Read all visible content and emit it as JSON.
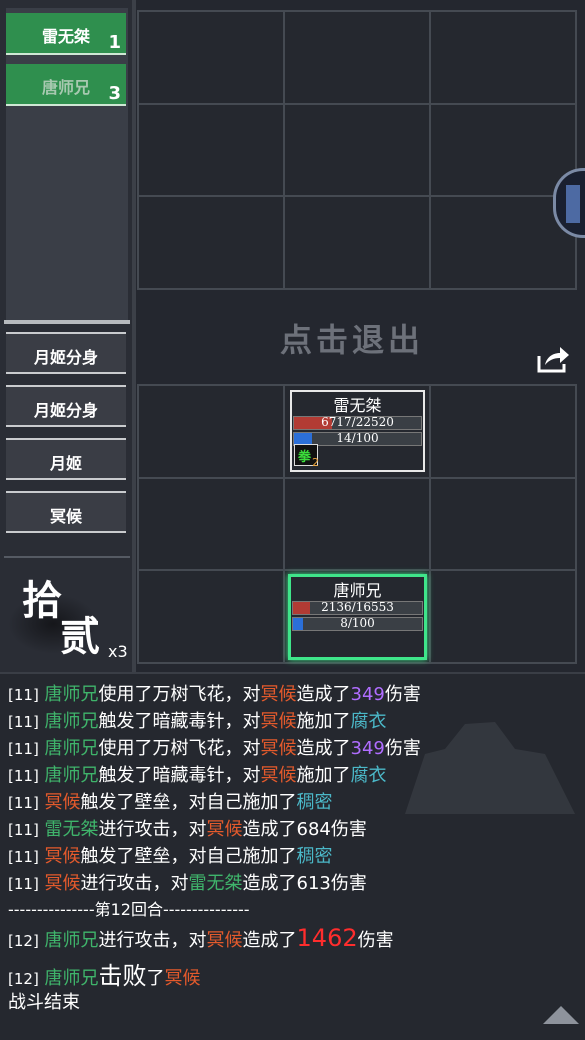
{
  "team": [
    {
      "name": "雷无桀",
      "num": "1"
    },
    {
      "name": "唐师兄",
      "num": "3"
    }
  ],
  "enemies": [
    "月姬分身",
    "月姬分身",
    "月姬",
    "冥候"
  ],
  "round_glyph": {
    "top": "拾",
    "bottom": "贰"
  },
  "multiplier": "x3",
  "exit_text": "点击退出",
  "units": {
    "lei": {
      "name": "雷无桀",
      "hp_text": "6717/22520",
      "hp_fraction": 0.298,
      "mp_text": "14/100",
      "mp_fraction": 0.14,
      "buff_glyph": "拳",
      "buff_stack": "2"
    },
    "tang": {
      "name": "唐师兄",
      "hp_text": "2136/16553",
      "hp_fraction": 0.129,
      "mp_text": "8/100",
      "mp_fraction": 0.08
    }
  },
  "log": {
    "l1": {
      "idx": "[11]",
      "a": "唐师兄",
      "b": "使用了万树飞花，对",
      "c": "冥候",
      "d": "造成了",
      "e": "349",
      "f": "伤害"
    },
    "l2": {
      "idx": "[11]",
      "a": "唐师兄",
      "b": "触发了暗藏毒针，对",
      "c": "冥候",
      "d": "施加了",
      "e": "腐衣"
    },
    "l3": {
      "idx": "[11]",
      "a": "唐师兄",
      "b": "使用了万树飞花，对",
      "c": "冥候",
      "d": "造成了",
      "e": "349",
      "f": "伤害"
    },
    "l4": {
      "idx": "[11]",
      "a": "唐师兄",
      "b": "触发了暗藏毒针，对",
      "c": "冥候",
      "d": "施加了",
      "e": "腐衣"
    },
    "l5": {
      "idx": "[11]",
      "a": "冥候",
      "b": "触发了壁垒，对自己施加了",
      "c": "稠密"
    },
    "l6": {
      "idx": "[11]",
      "a": "雷无桀",
      "b": "进行攻击，对",
      "c": "冥候",
      "d": "造成了684伤害"
    },
    "l7": {
      "idx": "[11]",
      "a": "冥候",
      "b": "触发了壁垒，对自己施加了",
      "c": "稠密"
    },
    "l8": {
      "idx": "[11]",
      "a": "冥候",
      "b": "进行攻击，对",
      "c": "雷无桀",
      "d": "造成了613伤害"
    },
    "l9": {
      "text": "---------------第12回合---------------"
    },
    "l10": {
      "idx": "[12]",
      "a": "唐师兄",
      "b": "进行攻击，对",
      "c": "冥候",
      "d": "造成了",
      "e": "1462",
      "f": "伤害"
    },
    "l11": {
      "idx": "[12]",
      "a": "唐师兄",
      "b": "击败",
      "c": "了",
      "d": "冥候"
    },
    "l12": {
      "text": "战斗结束"
    }
  },
  "colors": {
    "ally": "#3fb46b",
    "enemy": "#e45a2c",
    "damage": "#b06dff",
    "status": "#4bb8c8",
    "selected": "#3fe58a"
  }
}
